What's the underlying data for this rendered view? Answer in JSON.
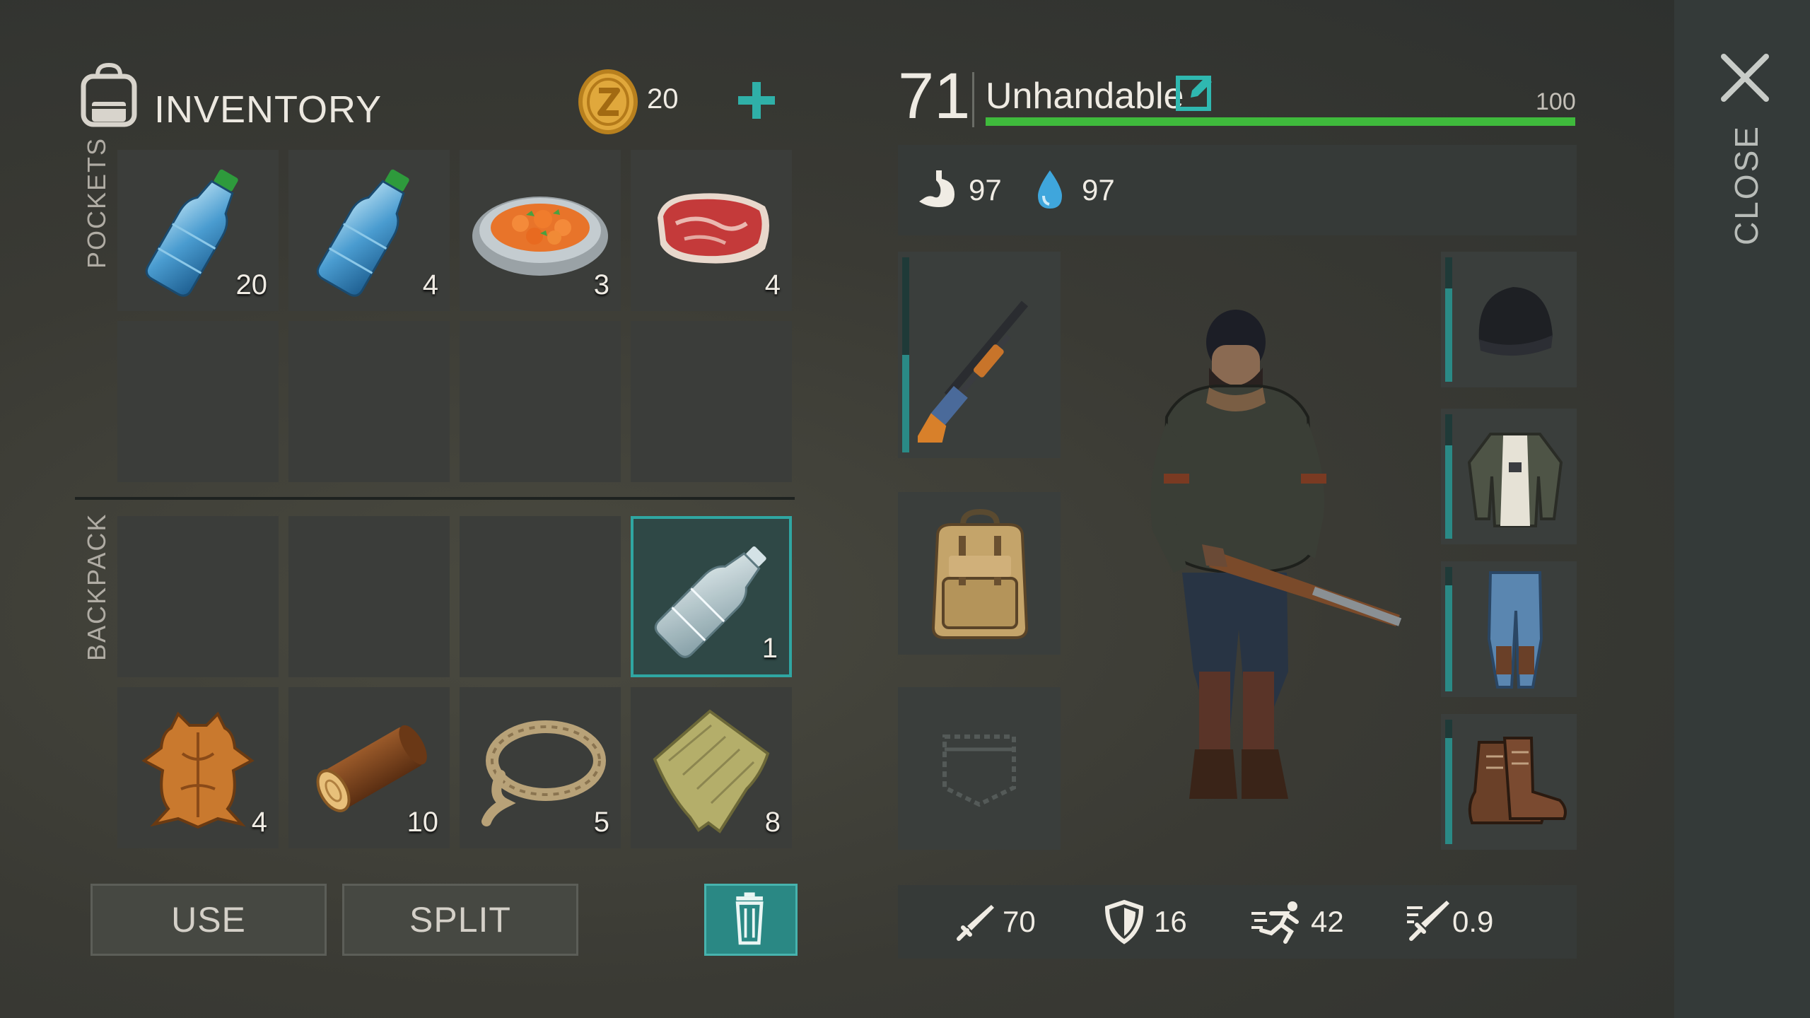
{
  "inventory": {
    "title": "INVENTORY",
    "coins": "20",
    "pockets_label": "POCKETS",
    "backpack_label": "BACKPACK",
    "pockets": [
      {
        "icon": "water-bottle-icon",
        "count": "20"
      },
      {
        "icon": "water-bottle-icon",
        "count": "4"
      },
      {
        "icon": "carrot-stew-icon",
        "count": "3"
      },
      {
        "icon": "raw-meat-icon",
        "count": "4"
      },
      {
        "icon": "",
        "count": ""
      },
      {
        "icon": "",
        "count": ""
      },
      {
        "icon": "",
        "count": ""
      },
      {
        "icon": "",
        "count": ""
      }
    ],
    "backpack": [
      {
        "icon": "",
        "count": ""
      },
      {
        "icon": "",
        "count": ""
      },
      {
        "icon": "",
        "count": ""
      },
      {
        "icon": "empty-bottle-icon",
        "count": "1",
        "selected": true
      },
      {
        "icon": "animal-hide-icon",
        "count": "4"
      },
      {
        "icon": "wood-log-icon",
        "count": "10"
      },
      {
        "icon": "rope-icon",
        "count": "5"
      },
      {
        "icon": "cloth-icon",
        "count": "8"
      }
    ],
    "use_label": "USE",
    "split_label": "SPLIT"
  },
  "character": {
    "level": "71",
    "name": "Unhandable",
    "xp_max": "100",
    "xp_fraction": 1.0,
    "food": "97",
    "water": "97",
    "equipment_left": [
      {
        "icon": "shotgun-icon",
        "durability": 0.5
      },
      {
        "icon": "backpack-icon"
      },
      {
        "icon": "pocket-icon"
      }
    ],
    "equipment_right": [
      {
        "icon": "beanie-icon",
        "durability": 0.75
      },
      {
        "icon": "jacket-icon",
        "durability": 0.75
      },
      {
        "icon": "jeans-icon",
        "durability": 0.85
      },
      {
        "icon": "boots-icon",
        "durability": 0.85
      }
    ],
    "attack": "70",
    "defense": "16",
    "speed": "42",
    "attack_speed": "0.9"
  },
  "close_label": "CLOSE",
  "colors": {
    "accent": "#2fa6a2",
    "xp_bar": "#3fba3c",
    "coin": "#d9a33a"
  }
}
